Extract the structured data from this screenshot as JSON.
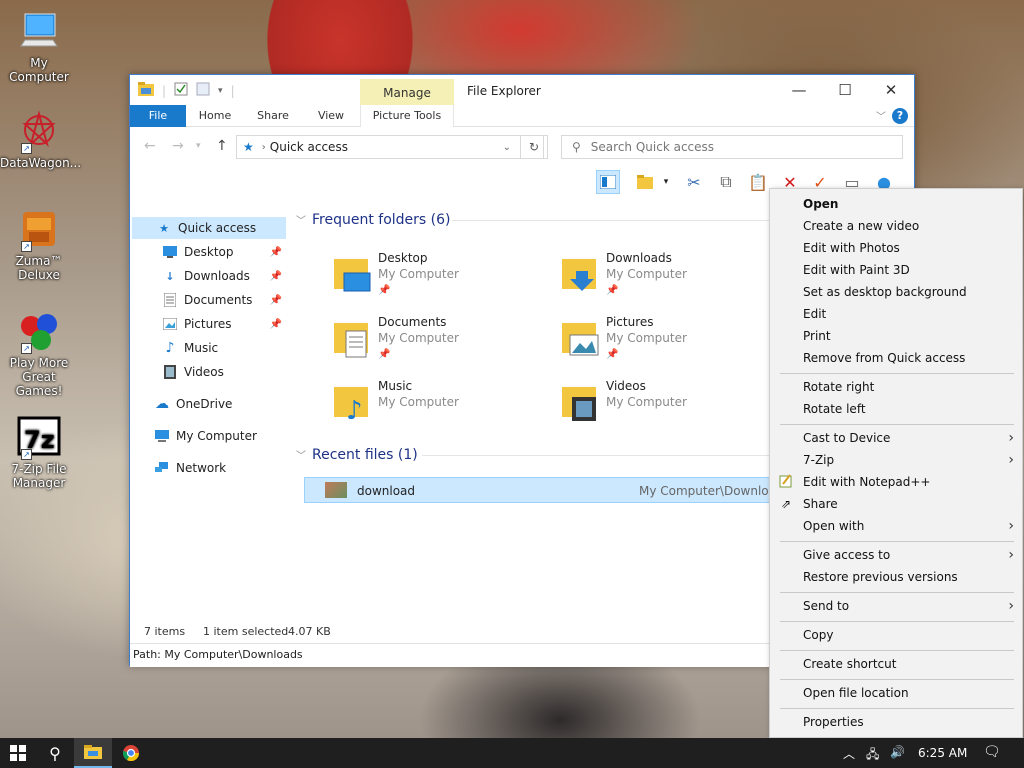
{
  "desktop": {
    "icons": [
      {
        "label": "My Computer"
      },
      {
        "label": "DataWagon..."
      },
      {
        "label": "Zuma™ Deluxe"
      },
      {
        "label": "Play More Great Games!"
      },
      {
        "label": "7-Zip File Manager"
      }
    ]
  },
  "window": {
    "title": "File Explorer",
    "manage_tab": "Manage",
    "ribbon_tabs": [
      "File",
      "Home",
      "Share",
      "View",
      "Picture Tools"
    ],
    "address": "Quick access",
    "search_placeholder": "Search Quick access"
  },
  "nav": {
    "items": [
      {
        "label": "Quick access",
        "icon": "star-icon"
      },
      {
        "label": "Desktop",
        "icon": "desktop-icon",
        "pinned": true
      },
      {
        "label": "Downloads",
        "icon": "download-icon",
        "pinned": true
      },
      {
        "label": "Documents",
        "icon": "documents-icon",
        "pinned": true
      },
      {
        "label": "Pictures",
        "icon": "pictures-icon",
        "pinned": true
      },
      {
        "label": "Music",
        "icon": "music-icon"
      },
      {
        "label": "Videos",
        "icon": "videos-icon"
      },
      {
        "label": "OneDrive",
        "icon": "onedrive-icon"
      },
      {
        "label": "My Computer",
        "icon": "computer-icon"
      },
      {
        "label": "Network",
        "icon": "network-icon"
      }
    ]
  },
  "content": {
    "frequent_header": "Frequent folders (6)",
    "folders": [
      {
        "name": "Desktop",
        "location": "My Computer",
        "pinned": true
      },
      {
        "name": "Downloads",
        "location": "My Computer",
        "pinned": true
      },
      {
        "name": "Documents",
        "location": "My Computer",
        "pinned": true
      },
      {
        "name": "Pictures",
        "location": "My Computer",
        "pinned": true
      },
      {
        "name": "Music",
        "location": "My Computer",
        "pinned": false
      },
      {
        "name": "Videos",
        "location": "My Computer",
        "pinned": false
      }
    ],
    "recent_header": "Recent files (1)",
    "recent_files": [
      {
        "name": "download",
        "location": "My Computer\\Downloads"
      }
    ]
  },
  "status": {
    "items": "7 items",
    "selected": "1 item selected",
    "size": "4.07 KB",
    "path": "Path: My Computer\\Downloads"
  },
  "context_menu": {
    "items": [
      {
        "label": "Open",
        "bold": true
      },
      {
        "label": "Create a new video"
      },
      {
        "label": "Edit with Photos"
      },
      {
        "label": "Edit with Paint 3D"
      },
      {
        "label": "Set as desktop background"
      },
      {
        "label": "Edit"
      },
      {
        "label": "Print"
      },
      {
        "label": "Remove from Quick access"
      },
      {
        "label": "Rotate right"
      },
      {
        "label": "Rotate left"
      },
      {
        "label": "Cast to Device",
        "submenu": true
      },
      {
        "label": "7-Zip",
        "submenu": true
      },
      {
        "label": "Edit with Notepad++",
        "icon": "notepadpp-icon"
      },
      {
        "label": "Share",
        "icon": "share-icon"
      },
      {
        "label": "Open with",
        "submenu": true
      },
      {
        "label": "Give access to",
        "submenu": true
      },
      {
        "label": "Restore previous versions"
      },
      {
        "label": "Send to",
        "submenu": true
      },
      {
        "label": "Copy"
      },
      {
        "label": "Create shortcut"
      },
      {
        "label": "Open file location"
      },
      {
        "label": "Properties"
      }
    ]
  },
  "taskbar": {
    "time": "6:25 AM"
  },
  "colors": {
    "accent": "#1979ca",
    "selection": "#cce8ff",
    "manage_tab": "#f5f0b5",
    "taskbar": "#1f1f1f",
    "menu_bg": "#f2f2f2"
  }
}
